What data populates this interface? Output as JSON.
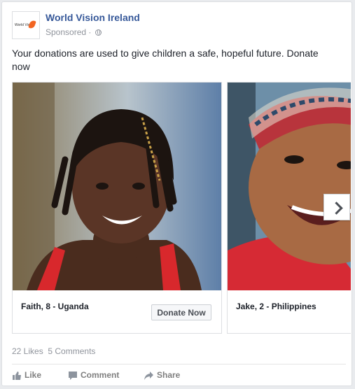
{
  "post": {
    "page_name": "World Vision Ireland",
    "logo_text": "World Vision",
    "sponsored_label": "Sponsored",
    "separator": "·",
    "message": "Your donations are used to give children a safe, hopeful future. Donate now"
  },
  "carousel": {
    "cards": [
      {
        "caption": "Faith, 8 - Uganda",
        "button": "Donate Now"
      },
      {
        "caption": "Jake, 2 - Philippines"
      }
    ]
  },
  "stats": {
    "likes": "22 Likes",
    "comments": "5 Comments"
  },
  "actions": {
    "like": "Like",
    "comment": "Comment",
    "share": "Share"
  },
  "colors": {
    "link": "#365899",
    "meta": "#90949c",
    "brand_orange": "#f26522"
  }
}
